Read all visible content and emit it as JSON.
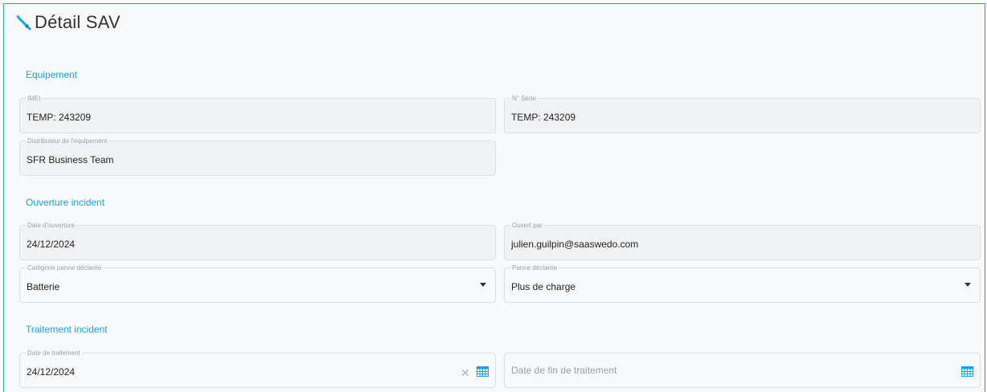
{
  "header": {
    "title": "Détail SAV",
    "icon": "wrench-icon"
  },
  "sections": {
    "equipement": "Equipement",
    "ouverture": "Ouverture incident",
    "traitement": "Traitement incident"
  },
  "fields": {
    "imei": {
      "label": "IMEI",
      "value": "TEMP: 243209"
    },
    "serie": {
      "label": "N° Série",
      "value": "TEMP: 243209"
    },
    "distributeur": {
      "label": "Distributeur de l'équipement",
      "value": "SFR Business Team"
    },
    "date_ouverture": {
      "label": "Date d'ouverture",
      "value": "24/12/2024"
    },
    "ouvert_par": {
      "label": "Ouvert par",
      "value": "julien.guilpin@saaswedo.com"
    },
    "categorie": {
      "label": "Catégorie panne déclarée",
      "value": "Batterie"
    },
    "panne": {
      "label": "Panne déclarée",
      "value": "Plus de charge"
    },
    "date_traitement": {
      "label": "Date de traitement",
      "value": "24/12/2024"
    },
    "date_fin": {
      "placeholder": "Date de fin de traitement"
    }
  },
  "colors": {
    "accent": "#1aa3d9",
    "text": "#222222",
    "muted": "#9aa0a6"
  }
}
